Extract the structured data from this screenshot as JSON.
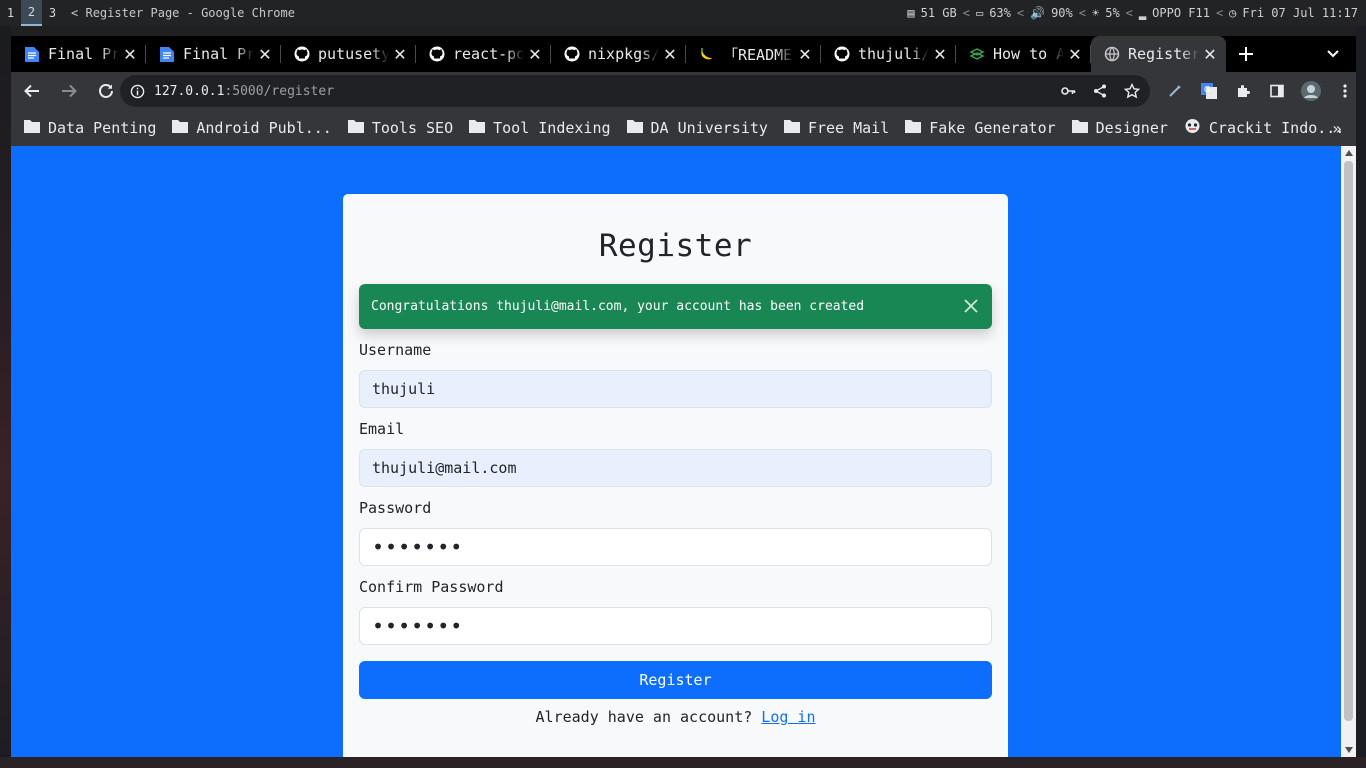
{
  "wm": {
    "workspaces": [
      "1",
      "2",
      "3"
    ],
    "active_workspace": "2",
    "title_prefix": "<",
    "window_title": "Register Page - Google Chrome",
    "disk": "51 GB",
    "battery": "63%",
    "volume": "90%",
    "brightness": "5%",
    "network": "OPPO F11",
    "datetime": "Fri 07 Jul 11:17",
    "sep": "<"
  },
  "tabs": [
    {
      "title": "Final Project",
      "icon": "google-docs-icon",
      "active": false
    },
    {
      "title": "Final Project",
      "icon": "google-docs-icon",
      "active": false
    },
    {
      "title": "putusetya",
      "icon": "github-icon",
      "active": false
    },
    {
      "title": "react-portfolio",
      "icon": "github-icon",
      "active": false
    },
    {
      "title": "nixpkgs/README",
      "icon": "github-icon",
      "active": false
    },
    {
      "title": "「README」",
      "icon": "banana-icon",
      "active": false
    },
    {
      "title": "thujuli/flask",
      "icon": "github-icon",
      "active": false
    },
    {
      "title": "How to Add",
      "icon": "codepen-icon",
      "active": false
    },
    {
      "title": "Register Page",
      "icon": "globe-icon",
      "active": true
    }
  ],
  "toolbar": {
    "url_host": "127.0.0.1",
    "url_rest": ":5000/register"
  },
  "bookmarks": [
    {
      "label": "Data Penting",
      "icon": "folder-icon"
    },
    {
      "label": "Android Publ...",
      "icon": "folder-icon"
    },
    {
      "label": "Tools SEO",
      "icon": "folder-icon"
    },
    {
      "label": "Tool Indexing",
      "icon": "folder-icon"
    },
    {
      "label": "DA University",
      "icon": "folder-icon"
    },
    {
      "label": "Free Mail",
      "icon": "folder-icon"
    },
    {
      "label": "Fake Generator",
      "icon": "folder-icon"
    },
    {
      "label": "Designer",
      "icon": "folder-icon"
    },
    {
      "label": "Crackit Indo...",
      "icon": "crackit-icon"
    }
  ],
  "bookmarks_more": "»",
  "page": {
    "title": "Register",
    "alert": "Congratulations thujuli@mail.com, your account has been created",
    "fields": {
      "username": {
        "label": "Username",
        "value": "thujuli"
      },
      "email": {
        "label": "Email",
        "value": "thujuli@mail.com"
      },
      "password": {
        "label": "Password",
        "value": "•••••••"
      },
      "confirm": {
        "label": "Confirm Password",
        "value": "•••••••"
      }
    },
    "submit": "Register",
    "login_prompt": "Already have an account?",
    "login_link": "Log in"
  },
  "colors": {
    "page_bg": "#0d6efd",
    "card_bg": "#f8f9fa",
    "alert_bg": "#198754",
    "button_bg": "#0d6efd",
    "autofill_bg": "#e8f0fe"
  }
}
